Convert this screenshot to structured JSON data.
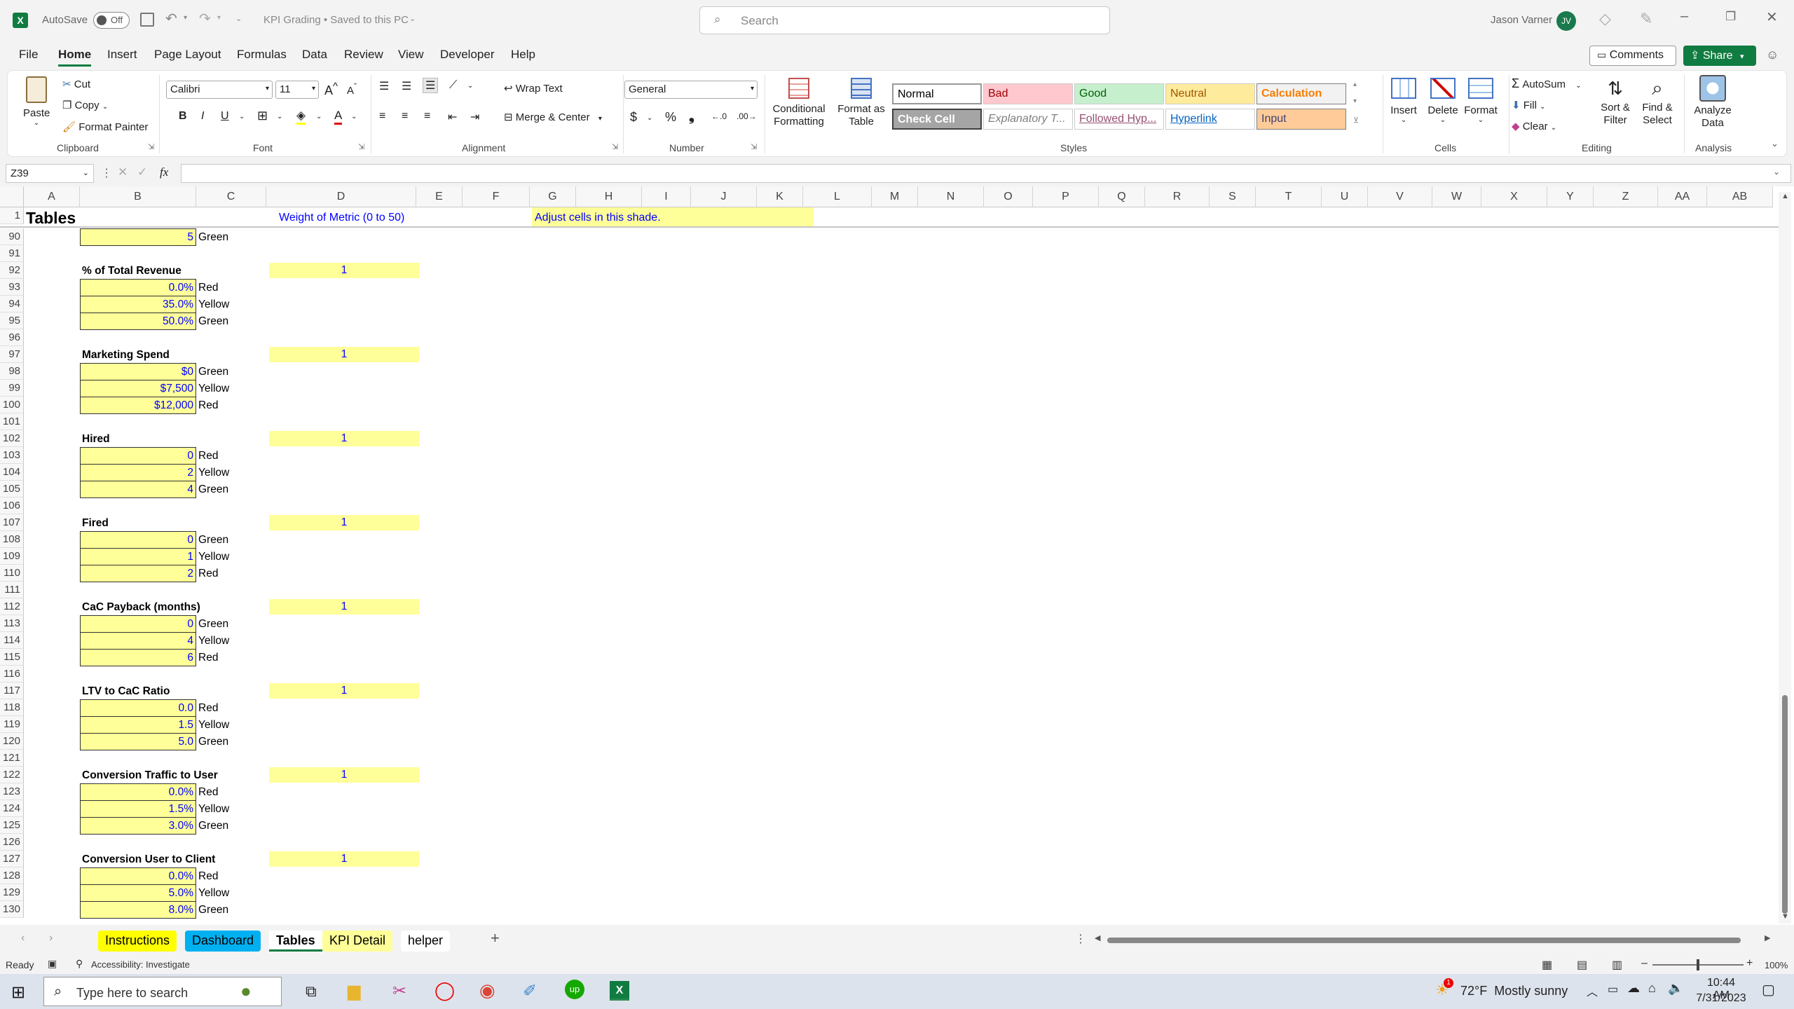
{
  "titlebar": {
    "autosave_label": "AutoSave",
    "autosave_state": "Off",
    "doc_title": "KPI Grading • Saved to this PC",
    "search_placeholder": "Search",
    "user_name": "Jason Varner",
    "user_initials": "JV"
  },
  "menu": [
    "File",
    "Home",
    "Insert",
    "Page Layout",
    "Formulas",
    "Data",
    "Review",
    "View",
    "Developer",
    "Help"
  ],
  "menu_active": "Home",
  "comments_label": "Comments",
  "share_label": "Share",
  "ribbon": {
    "clipboard": {
      "paste": "Paste",
      "cut": "Cut",
      "copy": "Copy",
      "format_painter": "Format Painter",
      "label": "Clipboard"
    },
    "font": {
      "name": "Calibri",
      "size": "11",
      "label": "Font"
    },
    "alignment": {
      "wrap": "Wrap Text",
      "merge": "Merge & Center",
      "label": "Alignment"
    },
    "number": {
      "format": "General",
      "label": "Number"
    },
    "styles": {
      "conditional": "Conditional Formatting",
      "format_table": "Format as Table",
      "label": "Styles",
      "boxes": [
        {
          "text": "Normal",
          "bg": "#ffffff",
          "color": "#000000"
        },
        {
          "text": "Bad",
          "bg": "#ffc7ce",
          "color": "#9c0006"
        },
        {
          "text": "Good",
          "bg": "#c6efce",
          "color": "#006100"
        },
        {
          "text": "Neutral",
          "bg": "#ffeb9c",
          "color": "#9c5700"
        },
        {
          "text": "Calculation",
          "bg": "#f2f2f2",
          "color": "#fa7d00"
        },
        {
          "text": "Check Cell",
          "bg": "#a5a5a5",
          "color": "#ffffff"
        },
        {
          "text": "Explanatory T...",
          "bg": "#ffffff",
          "color": "#7f7f7f"
        },
        {
          "text": "Followed Hyp...",
          "bg": "#ffffff",
          "color": "#954f72"
        },
        {
          "text": "Hyperlink",
          "bg": "#ffffff",
          "color": "#0563c1"
        },
        {
          "text": "Input",
          "bg": "#ffcc99",
          "color": "#3f3f76"
        }
      ]
    },
    "cells": {
      "insert": "Insert",
      "delete": "Delete",
      "format": "Format",
      "label": "Cells"
    },
    "editing": {
      "autosum": "AutoSum",
      "fill": "Fill",
      "clear": "Clear",
      "sort": "Sort & Filter",
      "find": "Find & Select",
      "label": "Editing"
    },
    "analysis": {
      "analyze": "Analyze Data",
      "label": "Analysis"
    }
  },
  "namebox": "Z39",
  "columns": [
    "A",
    "B",
    "C",
    "D",
    "E",
    "F",
    "G",
    "H",
    "I",
    "J",
    "K",
    "L",
    "M",
    "N",
    "O",
    "P",
    "Q",
    "R",
    "S",
    "T",
    "U",
    "V",
    "W",
    "X",
    "Y",
    "Z",
    "AA",
    "AB"
  ],
  "header_row": {
    "num": "1",
    "title": "Tables",
    "weight_label": "Weight of Metric (0 to 50)",
    "adjust_label": "Adjust cells in this shade."
  },
  "rows": [
    {
      "num": "90",
      "b": "5",
      "c": "Green"
    },
    {
      "num": "91"
    },
    {
      "num": "92",
      "section": "% of Total Revenue",
      "d": "1"
    },
    {
      "num": "93",
      "b": "0.0%",
      "c": "Red"
    },
    {
      "num": "94",
      "b": "35.0%",
      "c": "Yellow"
    },
    {
      "num": "95",
      "b": "50.0%",
      "c": "Green"
    },
    {
      "num": "96"
    },
    {
      "num": "97",
      "section": "Marketing Spend",
      "d": "1"
    },
    {
      "num": "98",
      "b": "$0",
      "c": "Green"
    },
    {
      "num": "99",
      "b": "$7,500",
      "c": "Yellow"
    },
    {
      "num": "100",
      "b": "$12,000",
      "c": "Red"
    },
    {
      "num": "101"
    },
    {
      "num": "102",
      "section": "Hired",
      "d": "1"
    },
    {
      "num": "103",
      "b": "0",
      "c": "Red"
    },
    {
      "num": "104",
      "b": "2",
      "c": "Yellow"
    },
    {
      "num": "105",
      "b": "4",
      "c": "Green"
    },
    {
      "num": "106"
    },
    {
      "num": "107",
      "section": "Fired",
      "d": "1"
    },
    {
      "num": "108",
      "b": "0",
      "c": "Green"
    },
    {
      "num": "109",
      "b": "1",
      "c": "Yellow"
    },
    {
      "num": "110",
      "b": "2",
      "c": "Red"
    },
    {
      "num": "111"
    },
    {
      "num": "112",
      "section": "CaC Payback (months)",
      "d": "1"
    },
    {
      "num": "113",
      "b": "0",
      "c": "Green"
    },
    {
      "num": "114",
      "b": "4",
      "c": "Yellow"
    },
    {
      "num": "115",
      "b": "6",
      "c": "Red"
    },
    {
      "num": "116"
    },
    {
      "num": "117",
      "section": "LTV to CaC Ratio",
      "d": "1"
    },
    {
      "num": "118",
      "b": "0.0",
      "c": "Red"
    },
    {
      "num": "119",
      "b": "1.5",
      "c": "Yellow"
    },
    {
      "num": "120",
      "b": "5.0",
      "c": "Green"
    },
    {
      "num": "121"
    },
    {
      "num": "122",
      "section": "Conversion Traffic to User",
      "d": "1"
    },
    {
      "num": "123",
      "b": "0.0%",
      "c": "Red"
    },
    {
      "num": "124",
      "b": "1.5%",
      "c": "Yellow"
    },
    {
      "num": "125",
      "b": "3.0%",
      "c": "Green"
    },
    {
      "num": "126"
    },
    {
      "num": "127",
      "section": "Conversion User to Client",
      "d": "1"
    },
    {
      "num": "128",
      "b": "0.0%",
      "c": "Red"
    },
    {
      "num": "129",
      "b": "5.0%",
      "c": "Yellow"
    },
    {
      "num": "130",
      "b": "8.0%",
      "c": "Green"
    }
  ],
  "sheet_tabs": [
    {
      "label": "Instructions",
      "bg": "#ffff00",
      "color": "#000000"
    },
    {
      "label": "Dashboard",
      "bg": "#00b0f0",
      "color": "#000000"
    },
    {
      "label": "Tables",
      "bg": "#ffffff",
      "color": "#000000"
    },
    {
      "label": "KPI Detail",
      "bg": "#ffff99",
      "color": "#000000"
    },
    {
      "label": "helper",
      "bg": "#ffffff",
      "color": "#000000"
    }
  ],
  "active_sheet": "Tables",
  "status": {
    "ready": "Ready",
    "accessibility": "Accessibility: Investigate",
    "zoom": "100%"
  },
  "taskbar": {
    "search_placeholder": "Type here to search",
    "weather": "72°F  Mostly sunny",
    "weather_badge": "1",
    "time": "10:44 AM",
    "date": "7/31/2023"
  }
}
